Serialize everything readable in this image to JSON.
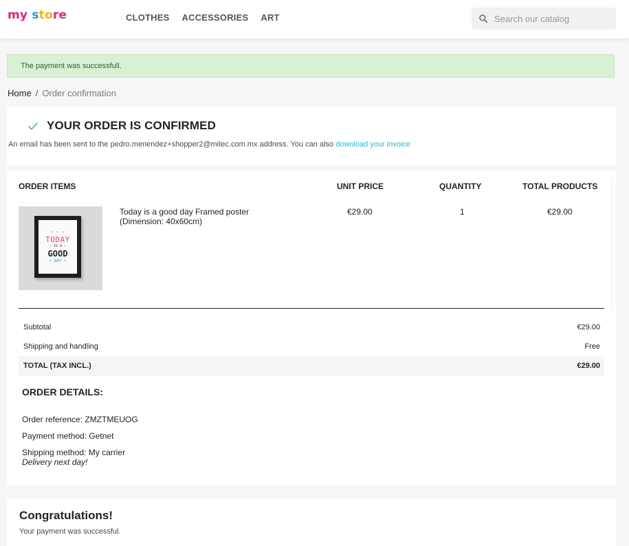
{
  "header": {
    "logo": {
      "part1": "my",
      "part2": " s",
      "part3": "to",
      "part4": "re"
    },
    "nav": [
      {
        "label": "CLOTHES"
      },
      {
        "label": "ACCESSORIES"
      },
      {
        "label": "ART"
      }
    ],
    "search": {
      "placeholder": "Search our catalog",
      "icon": "search-icon"
    }
  },
  "alert": {
    "text": "The payment was successfull."
  },
  "breadcrumb": {
    "home": "Home",
    "separator": "/",
    "current": "Order confirmation"
  },
  "confirmation": {
    "icon": "check-icon",
    "title": "YOUR ORDER IS CONFIRMED",
    "text": "An email has been sent to the pedro.menendez+shopper2@mitec.com.mx address. You can also ",
    "invoice_link": "download your invoice"
  },
  "order_items": {
    "headers": {
      "items": "ORDER ITEMS",
      "unit_price": "UNIT PRICE",
      "quantity": "QUANTITY",
      "total": "TOTAL PRODUCTS"
    },
    "products": [
      {
        "name": "Today is a good day Framed poster (Dimension: 40x60cm)",
        "unit_price": "€29.00",
        "quantity": "1",
        "total": "€29.00",
        "image": {
          "dots": "• • •",
          "line1": "TODAY",
          "line2": "— IS A —",
          "line3": "GOOD",
          "line4": "• DAY •"
        }
      }
    ],
    "summary": [
      {
        "label": "Subtotal",
        "value": "€29.00"
      },
      {
        "label": "Shipping and handling",
        "value": "Free"
      },
      {
        "label": "TOTAL (TAX INCL.)",
        "value": "€29.00"
      }
    ]
  },
  "order_details": {
    "title": "ORDER DETAILS:",
    "reference": "Order reference: ZMZTMEUOG",
    "payment": "Payment method: Getnet",
    "shipping": "Shipping method: My carrier",
    "delivery": "Delivery next day!"
  },
  "congratulations": {
    "title": "Congratulations!",
    "text": "Your payment was successful."
  },
  "colors": {
    "brand_pink": "#e4237f",
    "brand_blue": "#1a9ac9",
    "brand_yellow": "#f8b400",
    "link": "#24b9d7",
    "success_bg": "#d9f0d3"
  }
}
